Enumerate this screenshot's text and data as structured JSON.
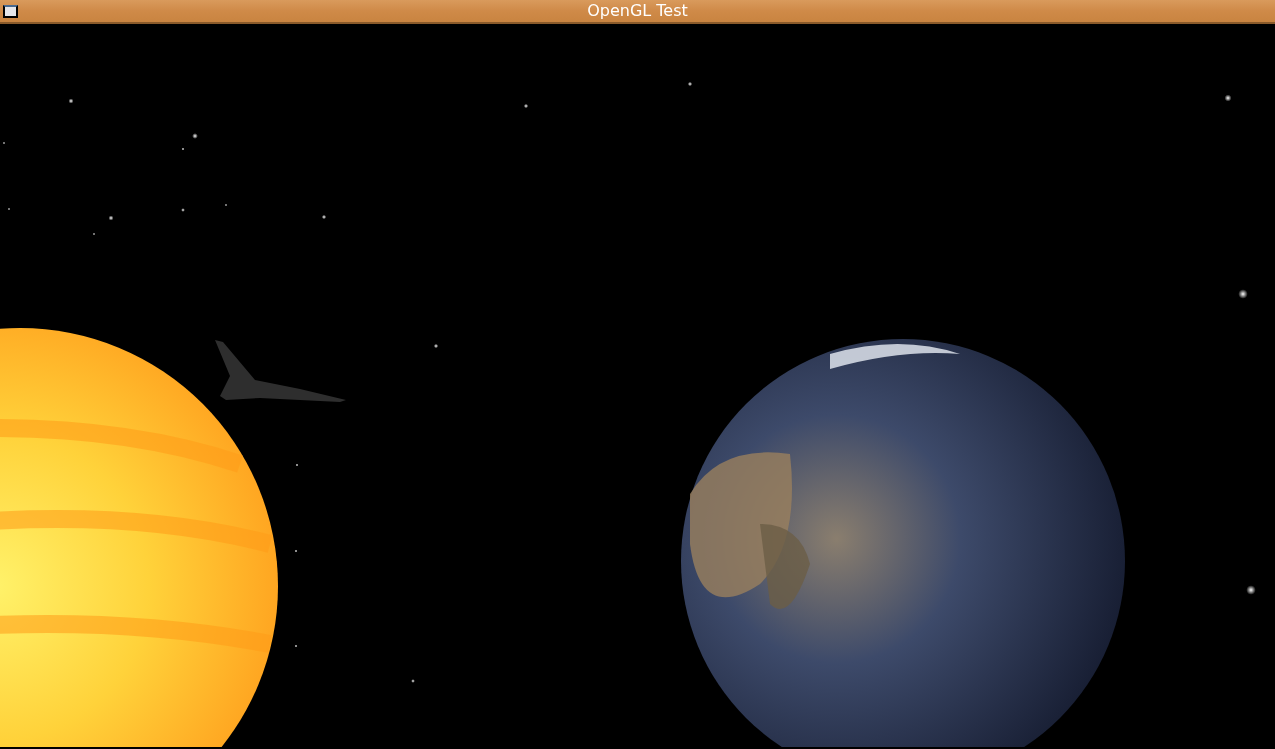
{
  "window": {
    "title": "OpenGL Test"
  }
}
